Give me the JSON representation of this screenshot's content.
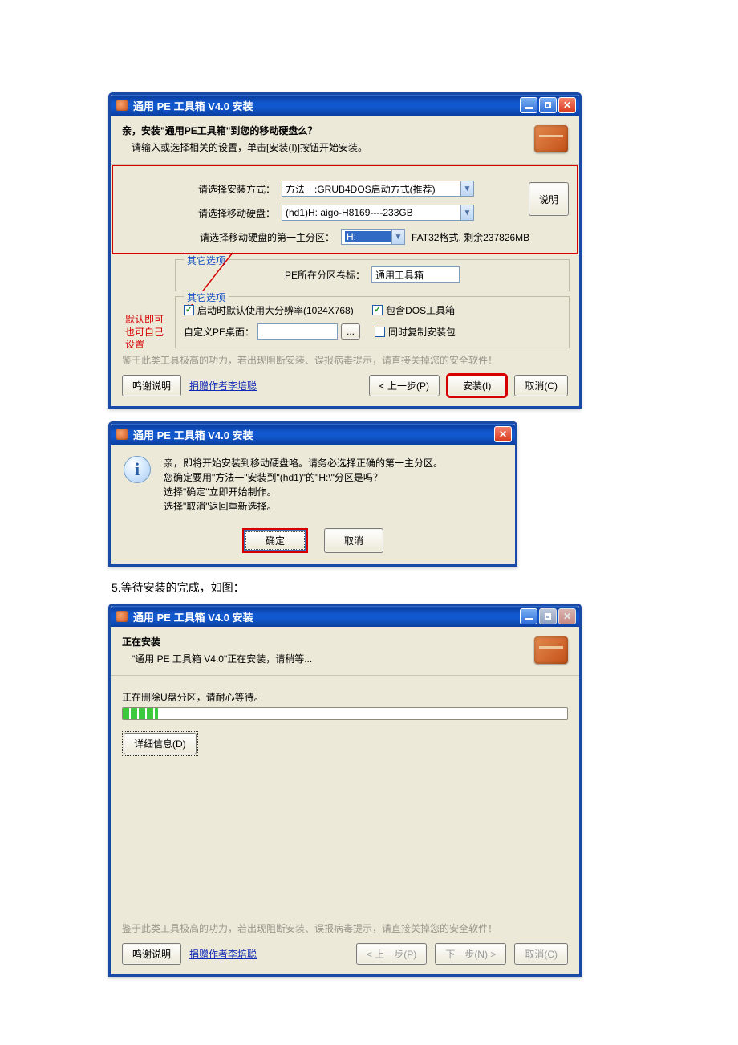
{
  "win1": {
    "title": "通用 PE 工具箱 V4.0 安装",
    "header_bold": "亲，安装\"通用PE工具箱\"到您的移动硬盘么？",
    "header_sub": "请输入或选择相关的设置，单击[安装(I)]按钮开始安装。",
    "lbl_method": "请选择安装方式：",
    "val_method": "方法一:GRUB4DOS启动方式(推荐)",
    "lbl_disk": "请选择移动硬盘：",
    "val_disk": "(hd1)H: aigo-H8169----233GB",
    "lbl_partition": "请选择移动硬盘的第一主分区：",
    "val_partition": "H:",
    "partition_info": "FAT32格式, 剩余237826MB",
    "btn_explain": "说明",
    "fs1_legend": "其它选项",
    "fs1_lbl": "PE所在分区卷标：",
    "fs1_val": "通用工具箱",
    "fs2_legend": "其它选项",
    "chk_res": "启动时默认使用大分辨率(1024X768)",
    "chk_dos": "包含DOS工具箱",
    "lbl_desktop": "自定义PE桌面：",
    "btn_browse": "...",
    "chk_copy": "同时复制安装包",
    "annotation": "默认即可\n也可自己\n设置",
    "warn": "鉴于此类工具极高的功力，若出现阻断安装、误报病毒提示，请直接关掉您的安全软件！",
    "btn_thanks": "鸣谢说明",
    "link_donate": "捐赠作者李培聪",
    "btn_prev": "< 上一步(P)",
    "btn_install": "安装(I)",
    "btn_cancel": "取消(C)"
  },
  "win2": {
    "title": "通用 PE 工具箱 V4.0 安装",
    "msg_l1": "亲，即将开始安装到移动硬盘咯。请务必选择正确的第一主分区。",
    "msg_l2": "您确定要用\"方法一\"安装到\"(hd1)\"的\"H:\\\"分区是吗？",
    "msg_l3": "选择\"确定\"立即开始制作。",
    "msg_l4": "选择\"取消\"返回重新选择。",
    "btn_ok": "确定",
    "btn_cancel": "取消"
  },
  "caption": "5.等待安装的完成，如图：",
  "win3": {
    "title": "通用 PE 工具箱 V4.0 安装",
    "hdr_bold": "正在安装",
    "hdr_sub": "\"通用 PE 工具箱 V4.0\"正在安装，请稍等...",
    "status": "正在删除U盘分区，请耐心等待。",
    "btn_detail": "详细信息(D)",
    "warn": "鉴于此类工具极高的功力，若出现阻断安装、误报病毒提示，请直接关掉您的安全软件！",
    "btn_thanks": "鸣谢说明",
    "link_donate": "捐赠作者李培聪",
    "btn_prev": "< 上一步(P)",
    "btn_next": "下一步(N) >",
    "btn_cancel": "取消(C)"
  }
}
